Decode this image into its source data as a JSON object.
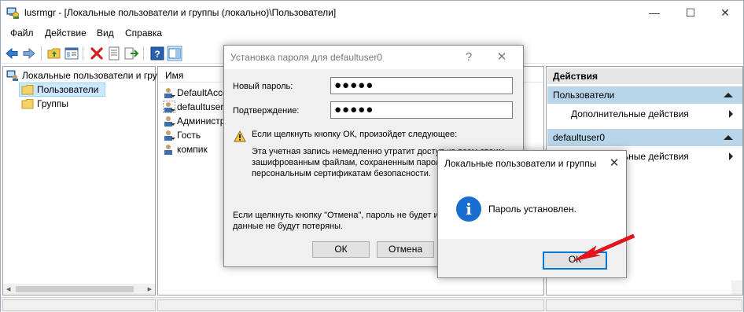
{
  "window": {
    "title": "lusrmgr - [Локальные пользователи и группы (локально)\\Пользователи]",
    "minimize_glyph": "—",
    "maximize_glyph": "☐",
    "close_glyph": "✕"
  },
  "menu": [
    "Файл",
    "Действие",
    "Вид",
    "Справка"
  ],
  "toolbar": {
    "icons": [
      "back-arrow-icon",
      "forward-arrow-icon",
      "up-folder-icon",
      "show-tree-icon",
      "delete-icon",
      "properties-icon",
      "export-list-icon",
      "help-icon",
      "action-pane-icon"
    ]
  },
  "tree": {
    "root": "Локальные пользователи и гру",
    "items": [
      "Пользователи",
      "Группы"
    ]
  },
  "list": {
    "column": "Имя",
    "rows": [
      "DefaultAcco",
      "defaultuser",
      "Администр",
      "Гость",
      "компик"
    ]
  },
  "actions": {
    "header": "Действия",
    "sections": [
      {
        "title": "Пользователи",
        "item": "Дополнительные действия"
      },
      {
        "title": "defaultuser0",
        "item": "Дополнительные действия"
      }
    ]
  },
  "password_dialog": {
    "title": "Установка пароля для defaultuser0",
    "help_glyph": "?",
    "close_glyph": "✕",
    "new_password_label": "Новый пароль:",
    "new_password_value": "●●●●●",
    "confirm_label": "Подтверждение:",
    "confirm_value": "●●●●●",
    "warning_title": "Если щелкнуть кнопку ОК, произойдет следующее:",
    "warning_line1": "Эта учетная запись немедленно утратит доступ ко всем своим",
    "warning_line2": "зашифрованным файлам, сохраненным паролям и",
    "warning_line3": "персональным сертификатам безопасности.",
    "cancel_note_line1": "Если щелкнуть кнопку \"Отмена\", пароль не будет изменен, и",
    "cancel_note_line2": "данные не будут потеряны.",
    "ok_label": "ОК",
    "cancel_label": "Отмена"
  },
  "info_dialog": {
    "title": "Локальные пользователи и группы",
    "close_glyph": "✕",
    "message": "Пароль установлен.",
    "ok_label": "ОК",
    "info_glyph": "i"
  },
  "colors": {
    "accent": "#0078d7",
    "selection": "#cce8ff",
    "action_section": "#b9d5ea",
    "annotation_arrow": "#e8121a"
  }
}
